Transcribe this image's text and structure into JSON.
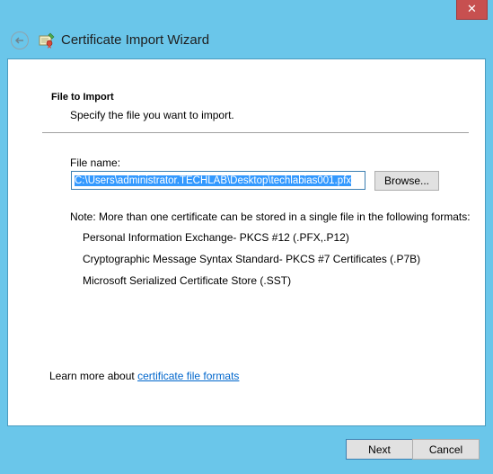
{
  "window": {
    "title": "Certificate Import Wizard",
    "close_label": "✕"
  },
  "page": {
    "section_title": "File to Import",
    "section_desc": "Specify the file you want to import.",
    "file_label": "File name:",
    "file_value": "C:\\Users\\administrator.TECHLAB\\Desktop\\techlabias001.pfx",
    "browse_label": "Browse...",
    "note": "Note:  More than one certificate can be stored in a single file in the following formats:",
    "formats": [
      "Personal Information Exchange- PKCS #12 (.PFX,.P12)",
      "Cryptographic Message Syntax Standard- PKCS #7 Certificates (.P7B)",
      "Microsoft Serialized Certificate Store (.SST)"
    ],
    "learn_prefix": "Learn more about ",
    "learn_link": "certificate file formats"
  },
  "footer": {
    "next_label": "Next",
    "cancel_label": "Cancel"
  },
  "colors": {
    "frame": "#6ac6ea",
    "close": "#c75050",
    "link": "#0066cc",
    "selection": "#3399ff"
  }
}
